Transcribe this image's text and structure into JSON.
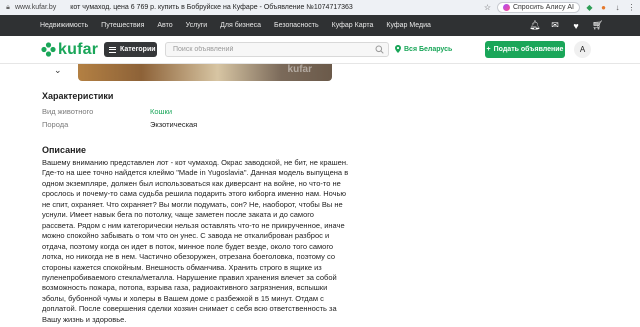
{
  "browser": {
    "url": "www.kufar.by",
    "tab_title": "кот чумаход. цена 6 769 р. купить в Бобруйске на Куфаре - Объявление №1074717363",
    "alice_label": "Спросить Алису AI",
    "icons": [
      "lock-icon",
      "star-icon",
      "shield-icon",
      "extension-icon",
      "download-icon",
      "menu-icon"
    ]
  },
  "topnav": {
    "links": [
      "Недвижимость",
      "Путешествия",
      "Авто",
      "Услуги",
      "Для бизнеса",
      "Безопасность",
      "Куфар Карта",
      "Куфар Медиа"
    ],
    "icons": [
      "bell-icon",
      "chat-icon",
      "heart-icon",
      "cart-icon"
    ]
  },
  "header": {
    "logo_text": "kufar",
    "categories_label": "Категории",
    "search_placeholder": "Поиск объявлений",
    "region_label": "Вся Беларусь",
    "post_label": "Подать объявление",
    "avatar_letter": "А",
    "brand_color": "#1aa659"
  },
  "photo": {
    "watermark": "kufar"
  },
  "characteristics": {
    "title": "Характеристики",
    "rows": [
      {
        "key": "Вид животного",
        "value": "Кошки"
      },
      {
        "key": "Порода",
        "value": "Экзотическая"
      }
    ]
  },
  "description": {
    "title": "Описание",
    "lines": [
      "Вашему вниманию представлен лот - кот чумаход. Окрас заводской, не бит, не крашен.",
      "Где-то на шее точно найдется клеймо \"Made in Yugoslavia\". Данная модель выпущена в",
      "одном экземпляре, должен был использоваться как диверсант на войне, но что-то не",
      "срослось и почему-то сама судьба решила подарить этого киборга именно нам. Ночью",
      "не спит, охраняет. Что охраняет? Вы могли подумать, сон? Не, наоборот, чтобы Вы не",
      "уснули. Имеет навык бега по потолку, чаще заметен после заката и до самого",
      "рассвета. Рядом с ним категорически нельзя оставлять что-то не прикрученное, иначе",
      "можно спокойно забывать о том что он унес. С завода не откалиброван разброс и",
      "отдача, поэтому когда он идет в поток, минное поле будет везде, около того самого",
      "лотка, но никогда не в нем. Частично обезоружен, отрезана боеголовка, поэтому со",
      "стороны кажется спокойным. Внешность обманчива. Хранить строго в ящике из",
      "пуленепробиваемого стекла/металла. Нарушение правил хранения влечет за собой",
      "возможность пожара, потопа, взрыва газа, радиоактивного загрязнения, вспышки",
      "эболы, бубонной чумы и холеры в Вашем доме с разбежкой в 15 минут. Отдам с",
      "доплатой. После совершения сделки хозяин снимает с себя всю ответственность за",
      "Вашу жизнь и здоровье."
    ]
  }
}
